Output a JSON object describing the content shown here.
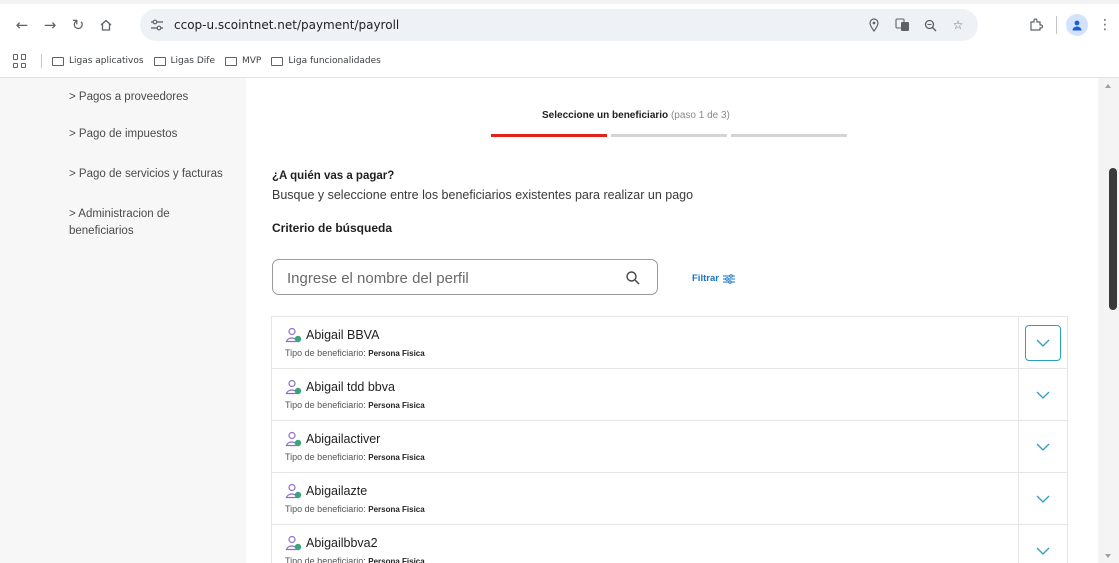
{
  "browser": {
    "url": "ccop-u.scointnet.net/payment/payroll",
    "bookmarks": [
      "Ligas aplicativos",
      "Ligas Dife",
      "MVP",
      "Liga funcionalidades"
    ]
  },
  "sidebar": {
    "items": [
      {
        "label": "> Pagos a proveedores"
      },
      {
        "label": "> Pago de impuestos"
      },
      {
        "label": "> Pago de servicios y facturas"
      },
      {
        "label": "> Administracion de beneficiarios"
      }
    ]
  },
  "stepper": {
    "title": "Seleccione un beneficiario",
    "step": "(paso 1 de 3)",
    "current_step": 1,
    "total_steps": 3
  },
  "main": {
    "heading": "¿A quién vas a pagar?",
    "subheading": "Busque y seleccione entre los beneficiarios existentes para realizar un pago",
    "criteria_label": "Criterio de búsqueda",
    "search_placeholder": "Ingrese el nombre del perfil",
    "filter_label": "Filtrar"
  },
  "beneficiaries": {
    "type_label": "Tipo de beneficiario:",
    "rows": [
      {
        "name": "Abigail BBVA",
        "type": "Persona Fisica"
      },
      {
        "name": "Abigail tdd bbva",
        "type": "Persona Fisica"
      },
      {
        "name": "Abigailactiver",
        "type": "Persona Fisica"
      },
      {
        "name": "Abigailazte",
        "type": "Persona Fisica"
      },
      {
        "name": "Abigailbbva2",
        "type": "Persona Fisica"
      }
    ]
  },
  "colors": {
    "accent_red": "#e2231a",
    "link_blue": "#1a73c8",
    "expand_teal": "#2a9fbf",
    "icon_green": "#3aa57a"
  }
}
